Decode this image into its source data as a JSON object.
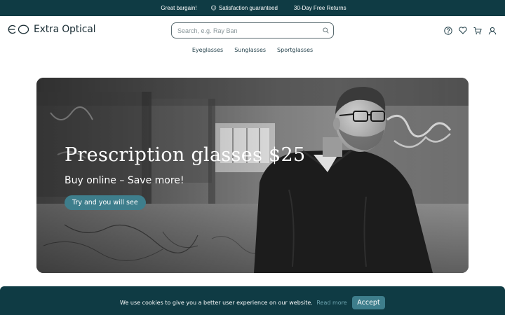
{
  "promo": {
    "items": [
      {
        "icon": "tag-icon",
        "glyph": "",
        "label": "Great bargain!"
      },
      {
        "icon": "smile-icon",
        "glyph": "☺",
        "label": "Satisfaction guaranteed"
      },
      {
        "icon": "return-box-icon",
        "glyph": "",
        "label": "30-Day Free Returns"
      }
    ]
  },
  "header": {
    "logo_text": "Extra Optical",
    "search_placeholder": "Search, e.g. Ray Ban",
    "icons": [
      "help-icon",
      "heart-icon",
      "cart-icon",
      "user-icon"
    ]
  },
  "nav": {
    "items": [
      "Eyeglasses",
      "Sunglasses",
      "Sportglasses"
    ]
  },
  "hero": {
    "title": "Prescription glasses $25",
    "subtitle": "Buy online – Save more!",
    "cta": "Try and you will see"
  },
  "cookie": {
    "text": "We use cookies to give you a better user experience on our website.",
    "link": "Read more",
    "accept": "Accept",
    "close": ""
  },
  "colors": {
    "dark_teal": "#0f3b44",
    "accent_teal": "#3e7e8c",
    "link_teal": "#6fa6b1"
  }
}
